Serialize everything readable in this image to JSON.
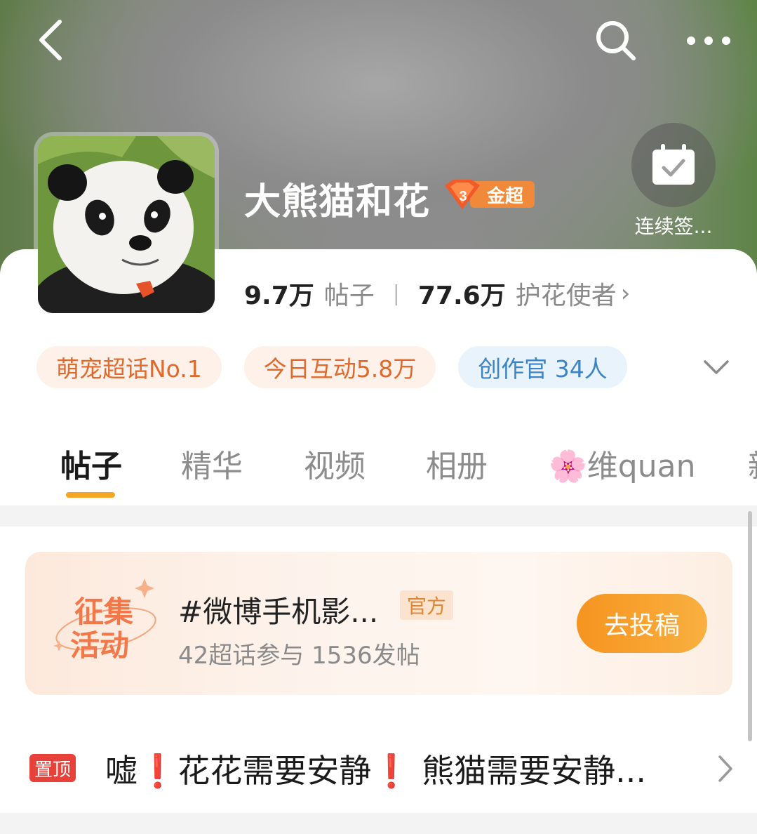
{
  "header": {
    "title": "大熊猫和花",
    "badge_level": "3",
    "badge_label": "金超",
    "checkin_label": "连续签..."
  },
  "stats": {
    "posts_count": "9.7万",
    "posts_label": "帖子",
    "separator": "|",
    "followers_count": "77.6万",
    "followers_label": "护花使者",
    "followers_chevron": "›"
  },
  "tags": [
    {
      "label": "萌宠超话No.1"
    },
    {
      "label": "今日互动5.8万"
    },
    {
      "label": "创作官 34人"
    }
  ],
  "tabs": [
    {
      "label": "帖子"
    },
    {
      "label": "精华"
    },
    {
      "label": "视频"
    },
    {
      "label": "相册"
    },
    {
      "label": "维quan",
      "emoji": "🌸"
    },
    {
      "label": "新"
    }
  ],
  "promo": {
    "icon_line1": "征集",
    "icon_line2": "活动",
    "title": "#微博手机影...",
    "official_label": "官方",
    "subtitle": "42超话参与 1536发帖",
    "button_label": "去投稿"
  },
  "pinned": {
    "badge": "置顶",
    "text": "嘘❗花花需要安静❗ 熊猫需要安静..."
  },
  "colors": {
    "accent_orange": "#f5a623",
    "tag_orange_text": "#e06a2c",
    "tag_blue_text": "#3d84c7",
    "pin_red": "#e8413a",
    "badge_orange": "#f08a3a"
  },
  "icons": [
    "back-icon",
    "search-icon",
    "more-icon",
    "calendar-check-icon",
    "chevron-down-icon",
    "chevron-right-icon",
    "sakura-icon",
    "gem-icon"
  ]
}
